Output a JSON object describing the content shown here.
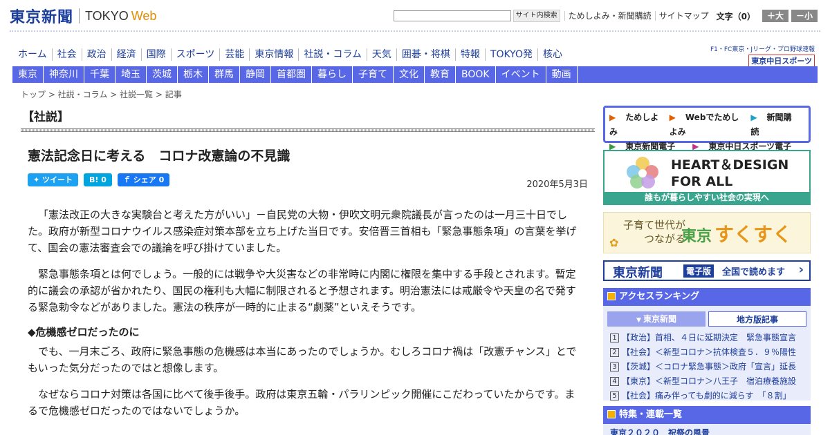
{
  "header": {
    "logo_jp": "東京新聞",
    "logo_en": "TOKYO",
    "logo_web": "Web",
    "search_button": "サイト内検索",
    "links": [
      "ためしよみ・新聞購読",
      "サイトマップ"
    ],
    "font_label": "文字（0）",
    "font_up": "＋大",
    "font_down": "－小"
  },
  "nav_main": [
    "ホーム",
    "社会",
    "政治",
    "経済",
    "国際",
    "スポーツ",
    "芸能",
    "東京情報",
    "社説・コラム",
    "天気",
    "囲碁・将棋",
    "特報",
    "TOKYO発",
    "核心"
  ],
  "chunichi": {
    "sub": "F1・FC東京・Jリーグ・プロ野球速報",
    "main": "東京中日スポーツ"
  },
  "nav_region": [
    "東京",
    "神奈川",
    "千葉",
    "埼玉",
    "茨城",
    "栃木",
    "群馬",
    "静岡",
    "首都圏",
    "暮らし",
    "子育て",
    "文化",
    "教育",
    "BOOK",
    "イベント",
    "動画"
  ],
  "breadcrumb": "トップ > 社説・コラム > 社説一覧 > 記事",
  "article": {
    "section": "【社説】",
    "title": "憲法記念日に考える　コロナ改憲論の不見識",
    "share": {
      "tweet": "ツイート",
      "hatena": "B! 0",
      "facebook": "シェア 0"
    },
    "date": "2020年5月3日",
    "p1": "「憲法改正の大きな実験台と考えた方がいい」－自民党の大物・伊吹文明元衆院議長が言ったのは一月三十日でした。政府が新型コロナウイルス感染症対策本部を立ち上げた当日です。安倍晋三首相も「緊急事態条項」の言葉を挙げて、国会の憲法審査会での議論を呼び掛けていました。",
    "p2": "緊急事態条項とは何でしょう。一般的には戦争や大災害などの非常時に内閣に権限を集中する手段とされます。暫定的に議会の承認が省かれたり、国民の権利も大幅に制限されると予想されます。明治憲法には戒厳令や天皇の名で発する緊急勅令などがありました。憲法の秩序が一時的に止まる“劇薬”といえそうです。",
    "h1": "◆危機感ゼロだったのに",
    "p3": "でも、一月末ごろ、政府に緊急事態の危機感は本当にあったのでしょうか。むしろコロナ禍は「改憲チャンス」とでもいった気分だったのではと想像します。",
    "p4": "なぜならコロナ対策は各国に比べて後手後手。政府は東京五輪・パラリンピック開催にこだわっていたからです。まるで危機感ゼロだったのではないでしょうか。"
  },
  "sidebar": {
    "links": [
      "ためしよみ",
      "Webでためしよみ",
      "新聞購読",
      "東京新聞電子版",
      "東京中日スポーツ電子版"
    ],
    "hd_line1": "HEART＆DESIGN",
    "hd_line2": "FOR ALL",
    "hd_strip": "誰もが暮らしやすい社会の実現へ",
    "sk_left1": "子育て世代が",
    "sk_left2": "つながる",
    "sk_tokyo": "東京",
    "sk_sukusuku": "すくすく",
    "den_jp": "東京新聞",
    "den_tag": "電子版",
    "den_txt": "全国で読めます",
    "ranking_title": "アクセスランキング",
    "ranking_tabs": [
      "東京新聞",
      "地方版記事"
    ],
    "ranking": [
      "【政治】首相、４日に延期決定　緊急事態宣言",
      "【社会】＜新型コロナ＞抗体検査５．９％陽性",
      "【茨城】＜コロナ緊急事態＞政府「宣言」延長",
      "【東京】＜新型コロナ＞八王子　宿泊療養施設",
      "【社会】痛み伴っても劇的に減らす　「８割」"
    ],
    "tokushu_title": "特集・連載一覧",
    "tokushu_peek": "東京２０２０　祝祭の風景"
  }
}
